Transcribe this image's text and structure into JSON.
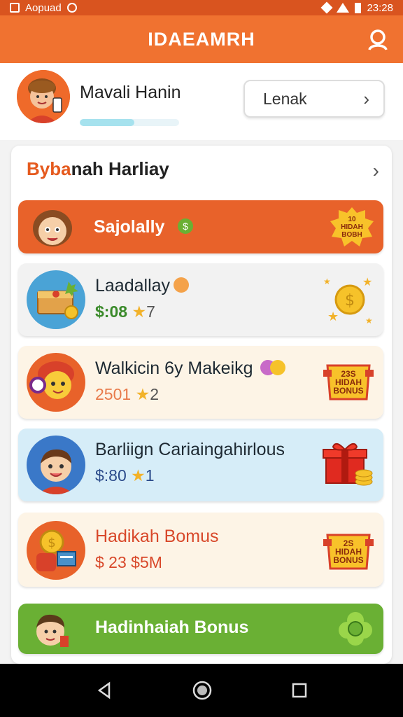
{
  "status_bar": {
    "app_label": "Aopuad",
    "time": "23:28"
  },
  "app_bar": {
    "title": "IDAEAMRH"
  },
  "profile": {
    "name": "Mavali Hanin",
    "level_button": "Lenak",
    "progress": 0.55
  },
  "section": {
    "title_accent": "Byba",
    "title_rest": "nah Harliay"
  },
  "rows": [
    {
      "title": "Sajolally",
      "variant": "orange",
      "badge_lines": [
        "10",
        "HIDAH",
        "BOBH"
      ]
    },
    {
      "title": "Laadallay",
      "value_prefix": "$:08",
      "value_suffix": "7",
      "variant": "grey"
    },
    {
      "title": "Walkicin 6y Makeikg",
      "value_prefix": "2501",
      "value_suffix": "2",
      "variant": "cream",
      "badge_lines": [
        "23S",
        "HIDAH",
        "BONUS"
      ]
    },
    {
      "title": "Barliign Cariaingahirlous",
      "value_prefix": "$:80",
      "value_suffix": "1",
      "variant": "blue"
    },
    {
      "title": "Hadikah Bomus",
      "value_prefix": "$ 23",
      "value_suffix": "$5M",
      "variant": "cream",
      "badge_lines": [
        "2S",
        "HIDAH",
        "BONUS"
      ]
    },
    {
      "title": "Hadinhaiah Bonus",
      "variant": "green"
    }
  ],
  "colors": {
    "primary": "#f07230",
    "status": "#d9541f",
    "green": "#6ab034",
    "blue_row": "#d6edf8",
    "cream_row": "#fdf4e6"
  },
  "icons": {
    "nav_back": "back-triangle-icon",
    "nav_home": "home-circle-icon",
    "nav_recent": "recent-square-icon"
  }
}
